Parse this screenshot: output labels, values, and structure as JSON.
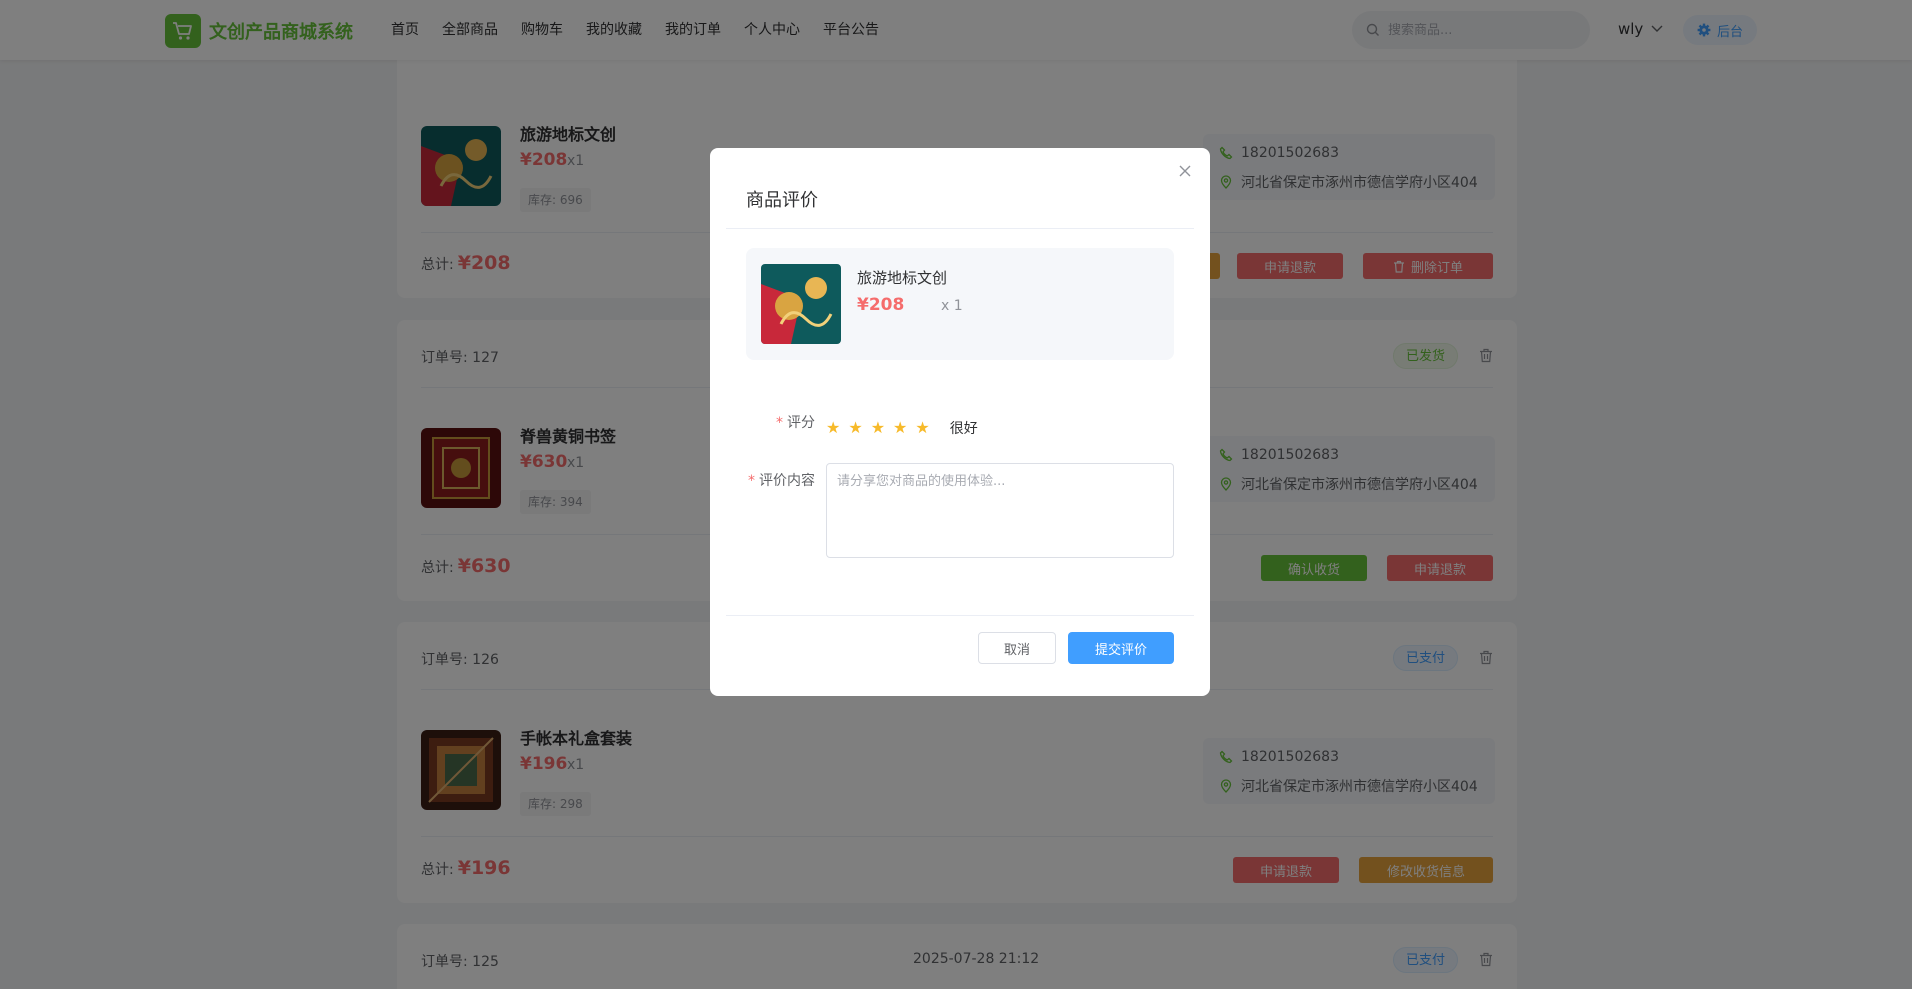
{
  "header": {
    "logo_text": "文创产品商城系统",
    "nav": [
      "首页",
      "全部商品",
      "购物车",
      "我的收藏",
      "我的订单",
      "个人中心",
      "平台公告"
    ],
    "search_placeholder": "搜索商品...",
    "username": "wly",
    "admin_label": "后台"
  },
  "top_card": {
    "product": {
      "name": "旅游地标文创",
      "price": "¥208",
      "qty": "x1",
      "stock": "库存: 696"
    },
    "address": {
      "phone": "18201502683",
      "addr": "河北省保定市涿州市德信学府小区404"
    },
    "total_label": "总计:",
    "total_value": "¥208",
    "buttons": [
      "申请退款",
      "删除订单"
    ]
  },
  "orders": [
    {
      "no": "订单号: 127",
      "status": "已发货",
      "product": {
        "name": "脊兽黄铜书签",
        "price": "¥630",
        "qty": "x1",
        "stock": "库存: 394"
      },
      "address": {
        "phone": "18201502683",
        "addr": "河北省保定市涿州市德信学府小区404"
      },
      "total_label": "总计:",
      "total_value": "¥630",
      "buttons": [
        "确认收货",
        "申请退款"
      ]
    },
    {
      "no": "订单号: 126",
      "status": "已支付",
      "product": {
        "name": "手帐本礼盒套装",
        "price": "¥196",
        "qty": "x1",
        "stock": "库存: 298"
      },
      "address": {
        "phone": "18201502683",
        "addr": "河北省保定市涿州市德信学府小区404"
      },
      "total_label": "总计:",
      "total_value": "¥196",
      "buttons": [
        "申请退款",
        "修改收货信息"
      ]
    },
    {
      "no": "订单号: 125",
      "time": "2025-07-28 21:12",
      "status": "已支付"
    }
  ],
  "dialog": {
    "title": "商品评价",
    "product": {
      "name": "旅游地标文创",
      "price": "¥208",
      "qty": "x 1"
    },
    "rating_label": "评分",
    "rating_value": 5,
    "rating_text": "很好",
    "content_label": "评价内容",
    "content_placeholder": "请分享您对商品的使用体验...",
    "cancel_label": "取消",
    "submit_label": "提交评价"
  },
  "colors": {
    "brand_green": "#67c23a",
    "primary_blue": "#409eff",
    "danger_red": "#f56c6c",
    "warning_orange": "#e6a23c"
  }
}
